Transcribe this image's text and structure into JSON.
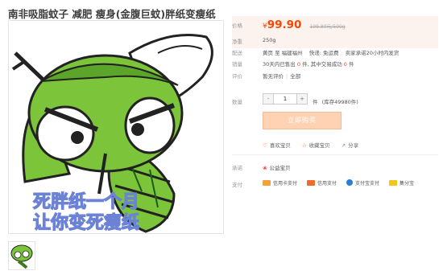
{
  "title": "南非吸脂蚊子 减肥 瘦身(金腹巨蚊)胖纸变瘦纸",
  "image": {
    "caption_line1": "死胖纸一个月",
    "caption_line2": "让你变死瘦纸"
  },
  "info": {
    "price_label": "价格",
    "price_symbol": "¥",
    "price_value": "99.90",
    "original_price": "199.80元/500g",
    "weight_label": "净重",
    "weight_value": "250g",
    "ship_label": "配送",
    "ship_from": "黄页 至 福建福州",
    "ship_fee": "快递: 免运费",
    "ship_promise": "卖家承诺20小时内发货",
    "sales_label": "销量",
    "sales_month_prefix": "30天内已售出",
    "sales_month_count": "0",
    "sales_month_suffix": "件, 其中交易成功",
    "sales_success_count": "0",
    "sales_success_suffix": "件",
    "review_label": "评价",
    "review_value": "暂无评价",
    "review_all": "全部",
    "qty_label": "数量",
    "qty_minus": "-",
    "qty_value": "1",
    "qty_plus": "+",
    "qty_unit": "件",
    "qty_stock": "(库存49980件)",
    "buy_label": "立即购买",
    "favorite_label": "喜欢宝贝",
    "collect_label": "收藏宝贝",
    "share_label": "分享",
    "commit_label": "承诺",
    "commit_value": "公益宝贝",
    "pay_label": "支付",
    "pay_options": [
      "信用卡支付",
      "信用支付",
      "支付宝支付",
      "集分宝"
    ]
  },
  "colors": {
    "price": "#ff4400",
    "buy_button": "#ffd2b4",
    "mosquito_green": "#7cc43a"
  }
}
